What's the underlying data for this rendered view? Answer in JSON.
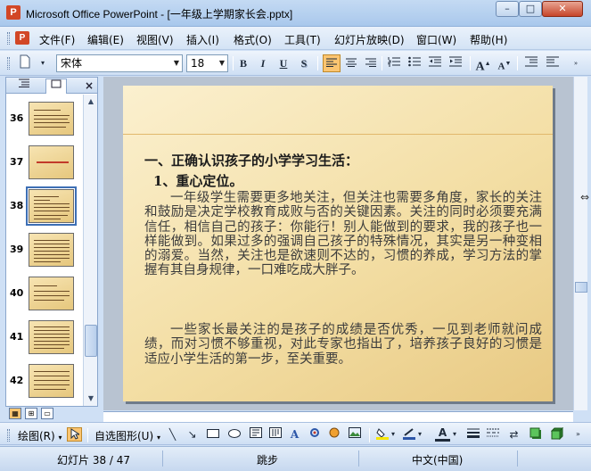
{
  "window": {
    "title": "Microsoft Office PowerPoint - [一年级上学期家长会.pptx]",
    "minimize_glyph": "–",
    "maximize_glyph": "□",
    "close_glyph": "✕"
  },
  "menu": {
    "items": [
      "文件(F)",
      "编辑(E)",
      "视图(V)",
      "插入(I)",
      "格式(O)",
      "工具(T)",
      "幻灯片放映(D)",
      "窗口(W)",
      "帮助(H)"
    ]
  },
  "format_toolbar": {
    "font_name": "宋体",
    "font_size": "18",
    "bold": "B",
    "italic": "I",
    "underline": "U",
    "shadow": "S",
    "grow_font": "A",
    "shrink_font": "A"
  },
  "slide_panel": {
    "tabs": [
      "outline-tab",
      "slides-tab"
    ],
    "close_glyph": "×",
    "thumbnails": [
      {
        "number": "36"
      },
      {
        "number": "37"
      },
      {
        "number": "38"
      },
      {
        "number": "39"
      },
      {
        "number": "40"
      },
      {
        "number": "41"
      },
      {
        "number": "42"
      }
    ],
    "selected_index": 2
  },
  "slide": {
    "heading": "一、正确认识孩子的小学学习生活：",
    "subheading": "1、重心定位。",
    "paragraph1": "一年级学生需要更多地关注，但关注也需要多角度，家长的关注和鼓励是决定学校教育成败与否的关键因素。关注的同时必须要充满信任，相信自己的孩子：你能行！别人能做到的要求，我的孩子也一样能做到。如果过多的强调自己孩子的特殊情况，其实是另一种变相的溺爱。当然，关注也是欲速则不达的，习惯的养成，学习方法的掌握有其自身规律，一口难吃成大胖子。",
    "paragraph2": "一些家长最关注的是孩子的成绩是否优秀，一见到老师就问成绩，而对习惯不够重视，对此专家也指出了，培养孩子良好的习惯是适应小学生活的第一步，至关重要。"
  },
  "drawing_toolbar": {
    "draw_label": "绘图(R)",
    "autoshapes_label": "自选图形(U)"
  },
  "status_bar": {
    "slide_position": "幻灯片 38 / 47",
    "design": "跳步",
    "language": "中文(中国)"
  },
  "colors": {
    "title_bar": "#a9c8ec",
    "active_button": "#fbc571",
    "slide_background": "#f3dea4",
    "slide_accent_line": "#e1b86c"
  }
}
